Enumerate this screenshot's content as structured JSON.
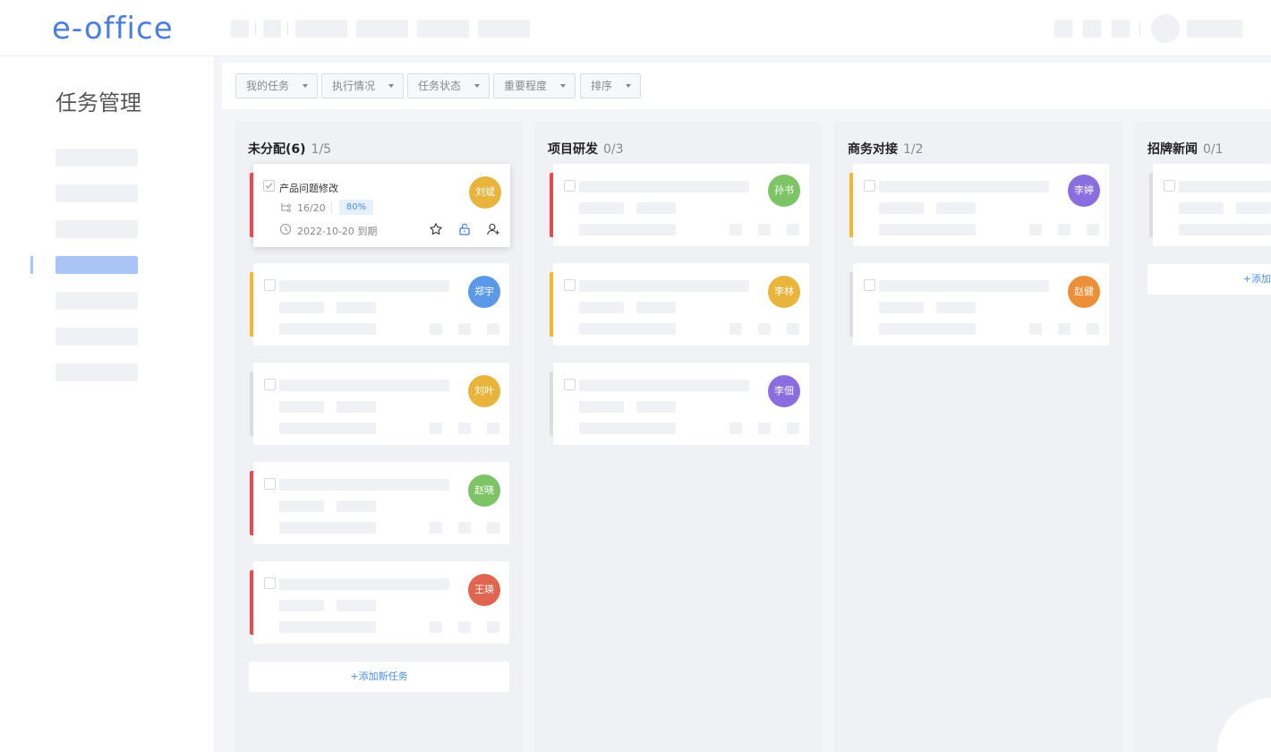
{
  "app": {
    "logo": "e-office"
  },
  "sidebar": {
    "title": "任务管理"
  },
  "filters": [
    {
      "label": "我的任务"
    },
    {
      "label": "执行情况"
    },
    {
      "label": "任务状态"
    },
    {
      "label": "重要程度"
    },
    {
      "label": "排序"
    }
  ],
  "columns": [
    {
      "title": "未分配(6)",
      "count": "1/5",
      "add_label": "+添加新任务",
      "cards": [
        {
          "assignee": "刘斌",
          "color": "#e9b43c",
          "stripe": "#f0474b",
          "title": "产品问题修改",
          "subtasks": "16/20",
          "progress": "80%",
          "due": "2022-10-20 到期",
          "active": true
        },
        {
          "assignee": "郑宇",
          "color": "#5c98e8",
          "stripe": "#f5b72c"
        },
        {
          "assignee": "刘叶",
          "color": "#e9b43c",
          "stripe": "#dcdde0"
        },
        {
          "assignee": "赵晓",
          "color": "#7cc465",
          "stripe": "#f0474b"
        },
        {
          "assignee": "王瑛",
          "color": "#e0654f",
          "stripe": "#f0474b"
        }
      ]
    },
    {
      "title": "项目研发",
      "count": "0/3",
      "cards": [
        {
          "assignee": "孙书",
          "color": "#7cc465",
          "stripe": "#f0474b"
        },
        {
          "assignee": "李林",
          "color": "#e9b43c",
          "stripe": "#f5b72c"
        },
        {
          "assignee": "李佃",
          "color": "#8a6ee0",
          "stripe": "#dcdde0"
        }
      ]
    },
    {
      "title": "商务对接",
      "count": "1/2",
      "cards": [
        {
          "assignee": "李婷",
          "color": "#8a6ee0",
          "stripe": "#f5b72c"
        },
        {
          "assignee": "赵健",
          "color": "#ec8f36",
          "stripe": "#dcdde0"
        }
      ]
    },
    {
      "title": "招牌新闻",
      "count": "0/1",
      "add_label": "+添加",
      "cards": [
        {
          "assignee": "",
          "color": "",
          "stripe": "#dcdde0"
        }
      ]
    }
  ]
}
